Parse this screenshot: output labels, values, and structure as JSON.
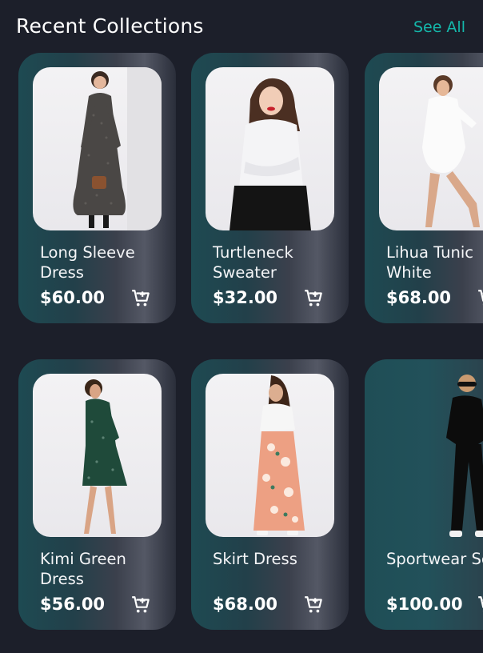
{
  "header": {
    "title": "Recent Collections",
    "see_all_label": "See All"
  },
  "colors": {
    "accent": "#14b8ab",
    "background": "#1c1f2a",
    "card_teal": "#1e4a52"
  },
  "products": [
    {
      "name": "Long Sleeve Dress",
      "price": "$60.00",
      "icon": "cart-add-icon"
    },
    {
      "name": "Turtleneck Sweater",
      "price": "$32.00",
      "icon": "cart-add-icon"
    },
    {
      "name": "Lihua Tunic White",
      "price": "$68.00",
      "icon": "cart-add-icon"
    },
    {
      "name": "Kimi Green Dress",
      "price": "$56.00",
      "icon": "cart-add-icon"
    },
    {
      "name": "Skirt Dress",
      "price": "$68.00",
      "icon": "cart-add-icon"
    },
    {
      "name": "Sportwear Set",
      "price": "$100.00",
      "icon": "cart-add-icon"
    }
  ]
}
